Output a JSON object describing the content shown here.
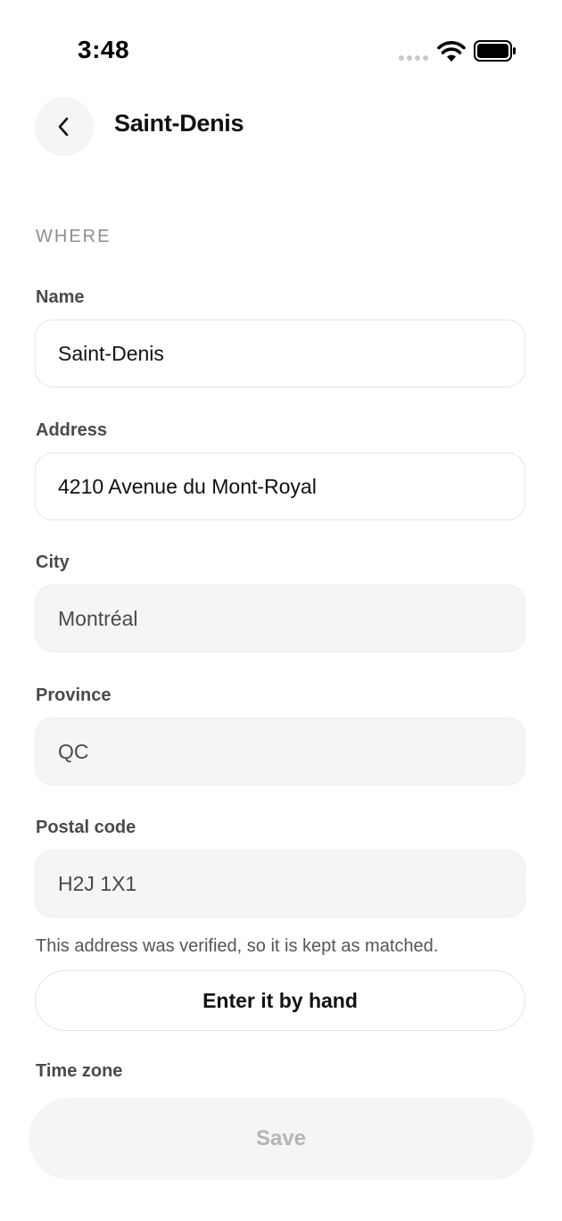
{
  "status_bar": {
    "time": "3:48"
  },
  "header": {
    "title": "Saint-Denis",
    "back_icon": "chevron-left-icon"
  },
  "section": {
    "label": "WHERE"
  },
  "fields": {
    "name": {
      "label": "Name",
      "value": "Saint-Denis"
    },
    "address": {
      "label": "Address",
      "value": "4210 Avenue du Mont-Royal"
    },
    "city": {
      "label": "City",
      "value": "Montréal"
    },
    "province": {
      "label": "Province",
      "value": "QC"
    },
    "postal_code": {
      "label": "Postal code",
      "value": "H2J 1X1"
    }
  },
  "helper": {
    "text": "This address was verified, so it is kept as matched."
  },
  "manual_button": {
    "label": "Enter it by hand"
  },
  "timezone": {
    "label": "Time zone"
  },
  "footer": {
    "save_label": "Save"
  },
  "colors": {
    "field_border": "#e6e6e6",
    "readonly_bg": "#f5f5f5",
    "disabled_text": "#b5b5b5"
  }
}
